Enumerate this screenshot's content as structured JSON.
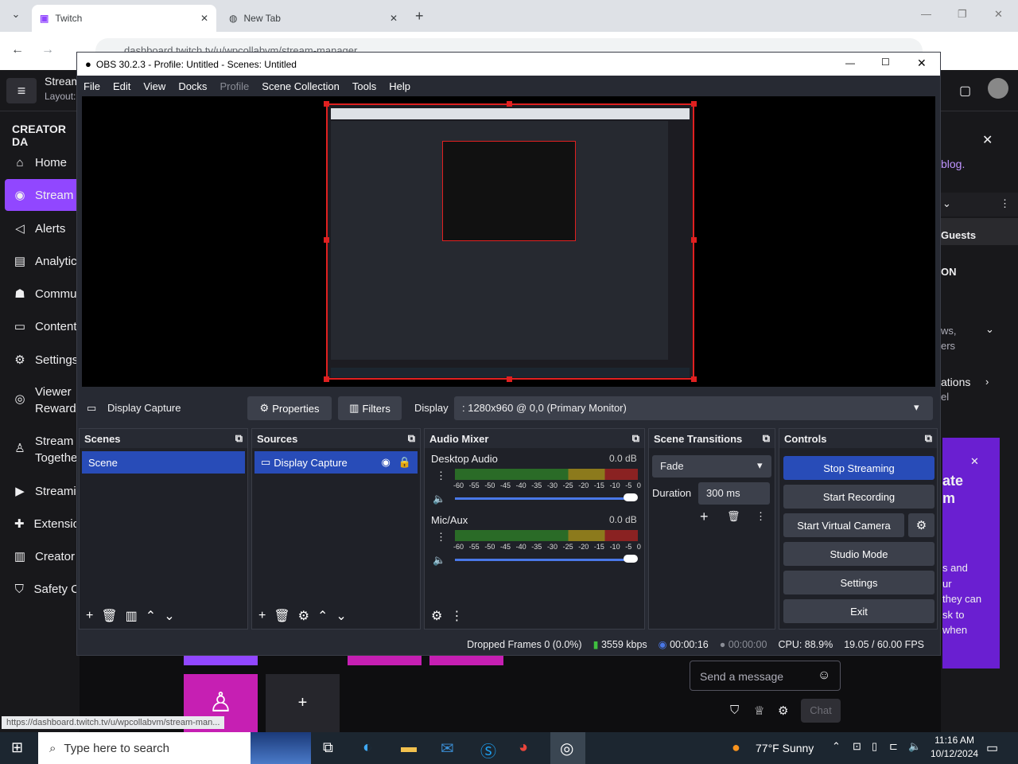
{
  "browser": {
    "tabs": [
      {
        "label": "Twitch"
      },
      {
        "label": "New Tab"
      }
    ],
    "address": "dashboard.twitch.tv/u/wpcollabvm/stream-manager",
    "status_url": "https://dashboard.twitch.tv/u/wpcollabvm/stream-man..."
  },
  "twitch": {
    "header_title": "Stream",
    "header_sub": "Layout:",
    "section": "CREATOR DA",
    "nav": [
      "Home",
      "Stream",
      "Alerts",
      "Analytic",
      "Commu",
      "Content",
      "Settings",
      "Viewer",
      "Reward",
      "Stream",
      "Togethe",
      "Streami",
      "Extensio",
      "Creator",
      "Safety C"
    ],
    "right": {
      "blog": "blog.",
      "guests": "Guests",
      "on": "ON",
      "ws": "ws,",
      "ers": "ers",
      "ations": "ations",
      "el": "el",
      "promo_title1": "ate",
      "promo_title2": "m",
      "promo_body": [
        "s and",
        "ur",
        "they can",
        "sk to",
        "when"
      ]
    },
    "chat_placeholder": "Send a message",
    "chat_btn": "Chat"
  },
  "obs": {
    "title": "OBS 30.2.3 - Profile: Untitled - Scenes: Untitled",
    "menu": [
      "File",
      "Edit",
      "View",
      "Docks",
      "Profile",
      "Scene Collection",
      "Tools",
      "Help"
    ],
    "source_name": "Display Capture",
    "properties": "Properties",
    "filters": "Filters",
    "display_label": "Display",
    "display_value": ": 1280x960 @ 0,0 (Primary Monitor)",
    "docks": {
      "scenes": "Scenes",
      "sources": "Sources",
      "audio": "Audio Mixer",
      "transitions": "Scene Transitions",
      "controls": "Controls"
    },
    "scene": "Scene",
    "source_item": "Display Capture",
    "audio": [
      {
        "name": "Desktop Audio",
        "db": "0.0 dB"
      },
      {
        "name": "Mic/Aux",
        "db": "0.0 dB"
      }
    ],
    "meter_ticks": [
      "-60",
      "-55",
      "-50",
      "-45",
      "-40",
      "-35",
      "-30",
      "-25",
      "-20",
      "-15",
      "-10",
      "-5",
      "0"
    ],
    "transition": "Fade",
    "duration_label": "Duration",
    "duration": "300 ms",
    "controls": [
      "Stop Streaming",
      "Start Recording",
      "Start Virtual Camera",
      "Studio Mode",
      "Settings",
      "Exit"
    ],
    "status": {
      "dropped": "Dropped Frames 0 (0.0%)",
      "kbps": "3559 kbps",
      "stream_time": "00:00:16",
      "rec_time": "00:00:00",
      "cpu": "CPU: 88.9%",
      "fps": "19.05 / 60.00 FPS"
    }
  },
  "taskbar": {
    "search": "Type here to search",
    "weather": "77°F  Sunny",
    "time": "11:16 AM",
    "date": "10/12/2024"
  },
  "colors": {
    "accent": "#284cb8",
    "twitch": "#9147ff",
    "recording_border": "#e02020"
  }
}
